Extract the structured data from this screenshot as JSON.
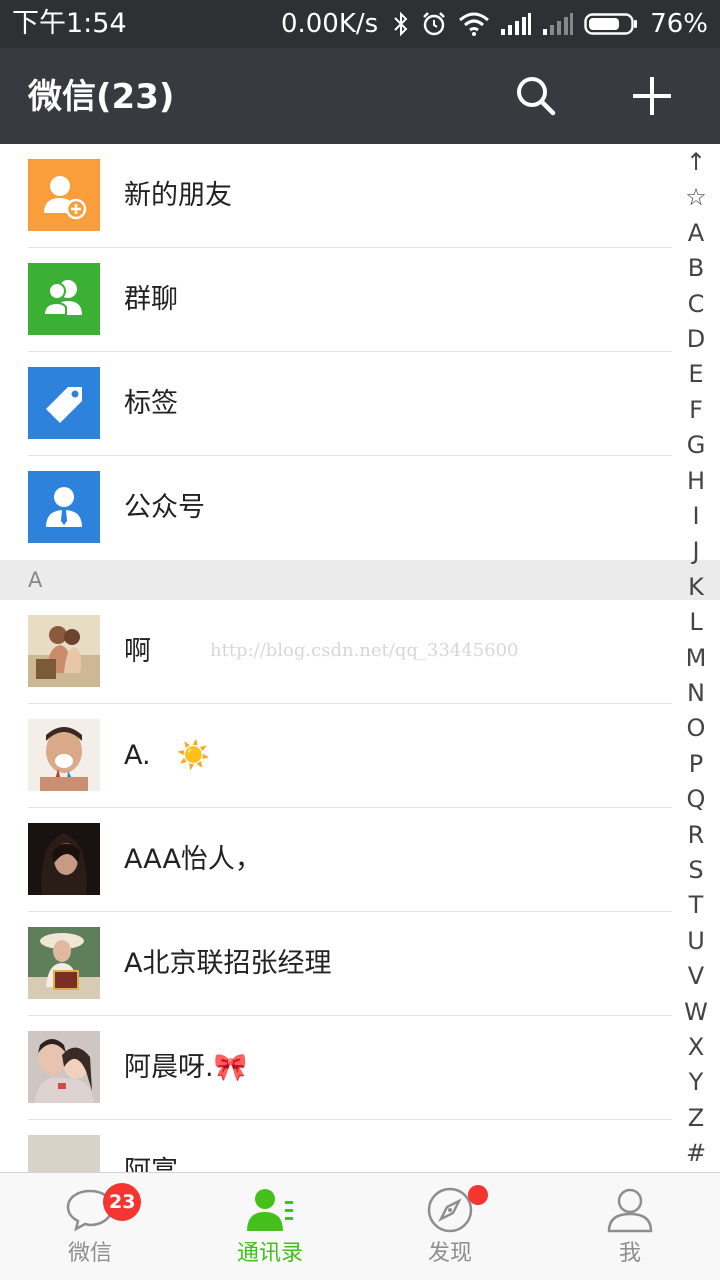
{
  "status_bar": {
    "time": "下午1:54",
    "network_speed": "0.00K/s",
    "battery_percent": "76%",
    "battery_level": 0.76,
    "icons": [
      "bluetooth-icon",
      "alarm-icon",
      "wifi-icon",
      "signal-icon",
      "signal-weak-icon",
      "battery-icon"
    ]
  },
  "header": {
    "title": "微信(23)",
    "search_icon": "search-icon",
    "add_icon": "plus-icon",
    "bg_color": "#393a3f"
  },
  "features": [
    {
      "label": "新的朋友",
      "icon": "add-friend-icon",
      "color": "#fa9d3b"
    },
    {
      "label": "群聊",
      "icon": "group-chat-icon",
      "color": "#3cb034"
    },
    {
      "label": "标签",
      "icon": "tag-icon",
      "color": "#2d82dc"
    },
    {
      "label": "公众号",
      "icon": "official-account-icon",
      "color": "#2d82dc"
    }
  ],
  "section": {
    "letter": "A"
  },
  "watermark": "http://blog.csdn.net/qq_33445600",
  "contacts": [
    {
      "name": "啊"
    },
    {
      "name": "A.",
      "emoji": "☀️"
    },
    {
      "name": "AAA怡人，"
    },
    {
      "name": "A北京联招张经理"
    },
    {
      "name": "阿晨呀.",
      "emoji": "🎀"
    },
    {
      "name": "阿富"
    }
  ],
  "index_letters": [
    "↑",
    "☆",
    "A",
    "B",
    "C",
    "D",
    "E",
    "F",
    "G",
    "H",
    "I",
    "J",
    "K",
    "L",
    "M",
    "N",
    "O",
    "P",
    "Q",
    "R",
    "S",
    "T",
    "U",
    "V",
    "W",
    "X",
    "Y",
    "Z",
    "#"
  ],
  "bottom_nav": {
    "items": [
      {
        "label": "微信",
        "icon": "chat-bubble-icon",
        "badge": "23"
      },
      {
        "label": "通讯录",
        "icon": "contacts-icon",
        "active": true
      },
      {
        "label": "发现",
        "icon": "compass-icon",
        "dot": true
      },
      {
        "label": "我",
        "icon": "profile-icon"
      }
    ],
    "active_color": "#45c01a",
    "badge_color": "#f43530"
  }
}
